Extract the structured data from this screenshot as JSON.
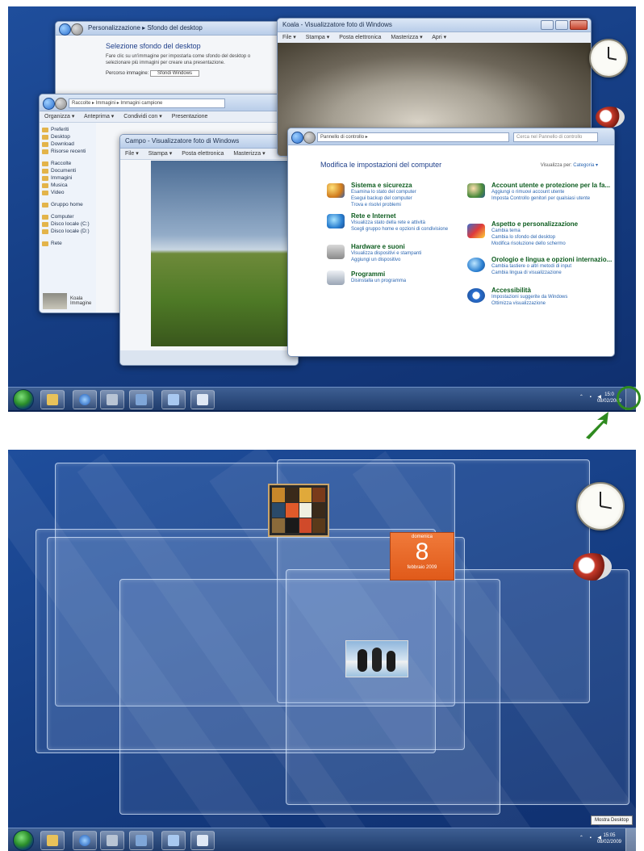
{
  "top_screenshot": {
    "window_desktop_bg": {
      "breadcrumb": "Personalizzazione ▸ Sfondo del desktop",
      "heading": "Selezione sfondo del desktop",
      "description": "Fare clic su un'immagine per impostarla come sfondo del desktop o selezionare più immagini per creare una presentazione.",
      "field_label": "Percorso immagine:",
      "field_value": "Sfondi Windows"
    },
    "window_explorer": {
      "address": "Raccolte ▸ Immagini ▸ Immagini campione",
      "toolbar": [
        "Organizza ▾",
        "Anteprima ▾",
        "Condividi con ▾",
        "Presentazione"
      ],
      "sidebar": [
        "Preferiti",
        "Desktop",
        "Download",
        "Risorse recenti",
        "Raccolte",
        "Documenti",
        "Immagini",
        "Musica",
        "Video",
        "Gruppo home",
        "Computer",
        "Disco locale (C:)",
        "Disco locale (D:)",
        "Rete"
      ],
      "footer_item": "Koala",
      "footer_sub": "Immagine"
    },
    "window_photo_viewer_small": {
      "title": "Campo - Visualizzatore foto di Windows",
      "menu": [
        "File ▾",
        "Stampa ▾",
        "Posta elettronica",
        "Masterizza ▾"
      ]
    },
    "window_photo_viewer_koala": {
      "title": "Koala - Visualizzatore foto di Windows",
      "menu": [
        "File ▾",
        "Stampa ▾",
        "Posta elettronica",
        "Masterizza ▾",
        "Apri ▾"
      ]
    },
    "window_control_panel": {
      "address": "Pannello di controllo ▸",
      "search_placeholder": "Cerca nel Pannello di controllo",
      "heading": "Modifica le impostazioni del computer",
      "view_label": "Visualizza per:",
      "view_value": "Categoria ▾",
      "left_items": [
        {
          "title": "Sistema e sicurezza",
          "links": [
            "Esamina lo stato del computer",
            "Esegui backup del computer",
            "Trova e risolvi problemi"
          ]
        },
        {
          "title": "Rete e Internet",
          "links": [
            "Visualizza stato della rete e attività",
            "Scegli gruppo home e opzioni di condivisione"
          ]
        },
        {
          "title": "Hardware e suoni",
          "links": [
            "Visualizza dispositivi e stampanti",
            "Aggiungi un dispositivo"
          ]
        },
        {
          "title": "Programmi",
          "links": [
            "Disinstalla un programma"
          ]
        }
      ],
      "right_items": [
        {
          "title": "Account utente e protezione per la fa...",
          "links": [
            "Aggiungi o rimuovi account utente",
            "Imposta Controllo genitori per qualsiasi utente"
          ]
        },
        {
          "title": "Aspetto e personalizzazione",
          "links": [
            "Cambia tema",
            "Cambia lo sfondo del desktop",
            "Modifica risoluzione dello schermo"
          ]
        },
        {
          "title": "Orologio e lingua e opzioni internazio...",
          "links": [
            "Cambia tastiere o altri metodi di input",
            "Cambia lingua di visualizzazione"
          ]
        },
        {
          "title": "Accessibilità",
          "links": [
            "Impostazioni suggerite da Windows",
            "Ottimizza visualizzazione"
          ]
        }
      ]
    },
    "taskbar_clock": {
      "time": "15:0",
      "date": "08/02/2009"
    }
  },
  "bottom_screenshot": {
    "calendar_gadget": {
      "day_name": "domenica",
      "day_number": "8",
      "month_year": "febbraio 2009"
    },
    "taskbar_clock": {
      "time": "15:05",
      "date": "08/02/2009"
    },
    "tooltip": "Mostra Desktop"
  },
  "colors": {
    "desktop_blue": "#163f86",
    "taskbar": "#2a4a7f",
    "highlight_arrow": "#2e8a1f",
    "calendar_orange": "#e8662a"
  },
  "icons": [
    "start-orb-icon",
    "explorer-icon",
    "help-icon",
    "control-panel-icon",
    "photo-viewer-icon",
    "window-switch-icon",
    "folder-icon",
    "clock-gadget-icon",
    "cpu-meter-gadget-icon",
    "arrow-icon"
  ]
}
